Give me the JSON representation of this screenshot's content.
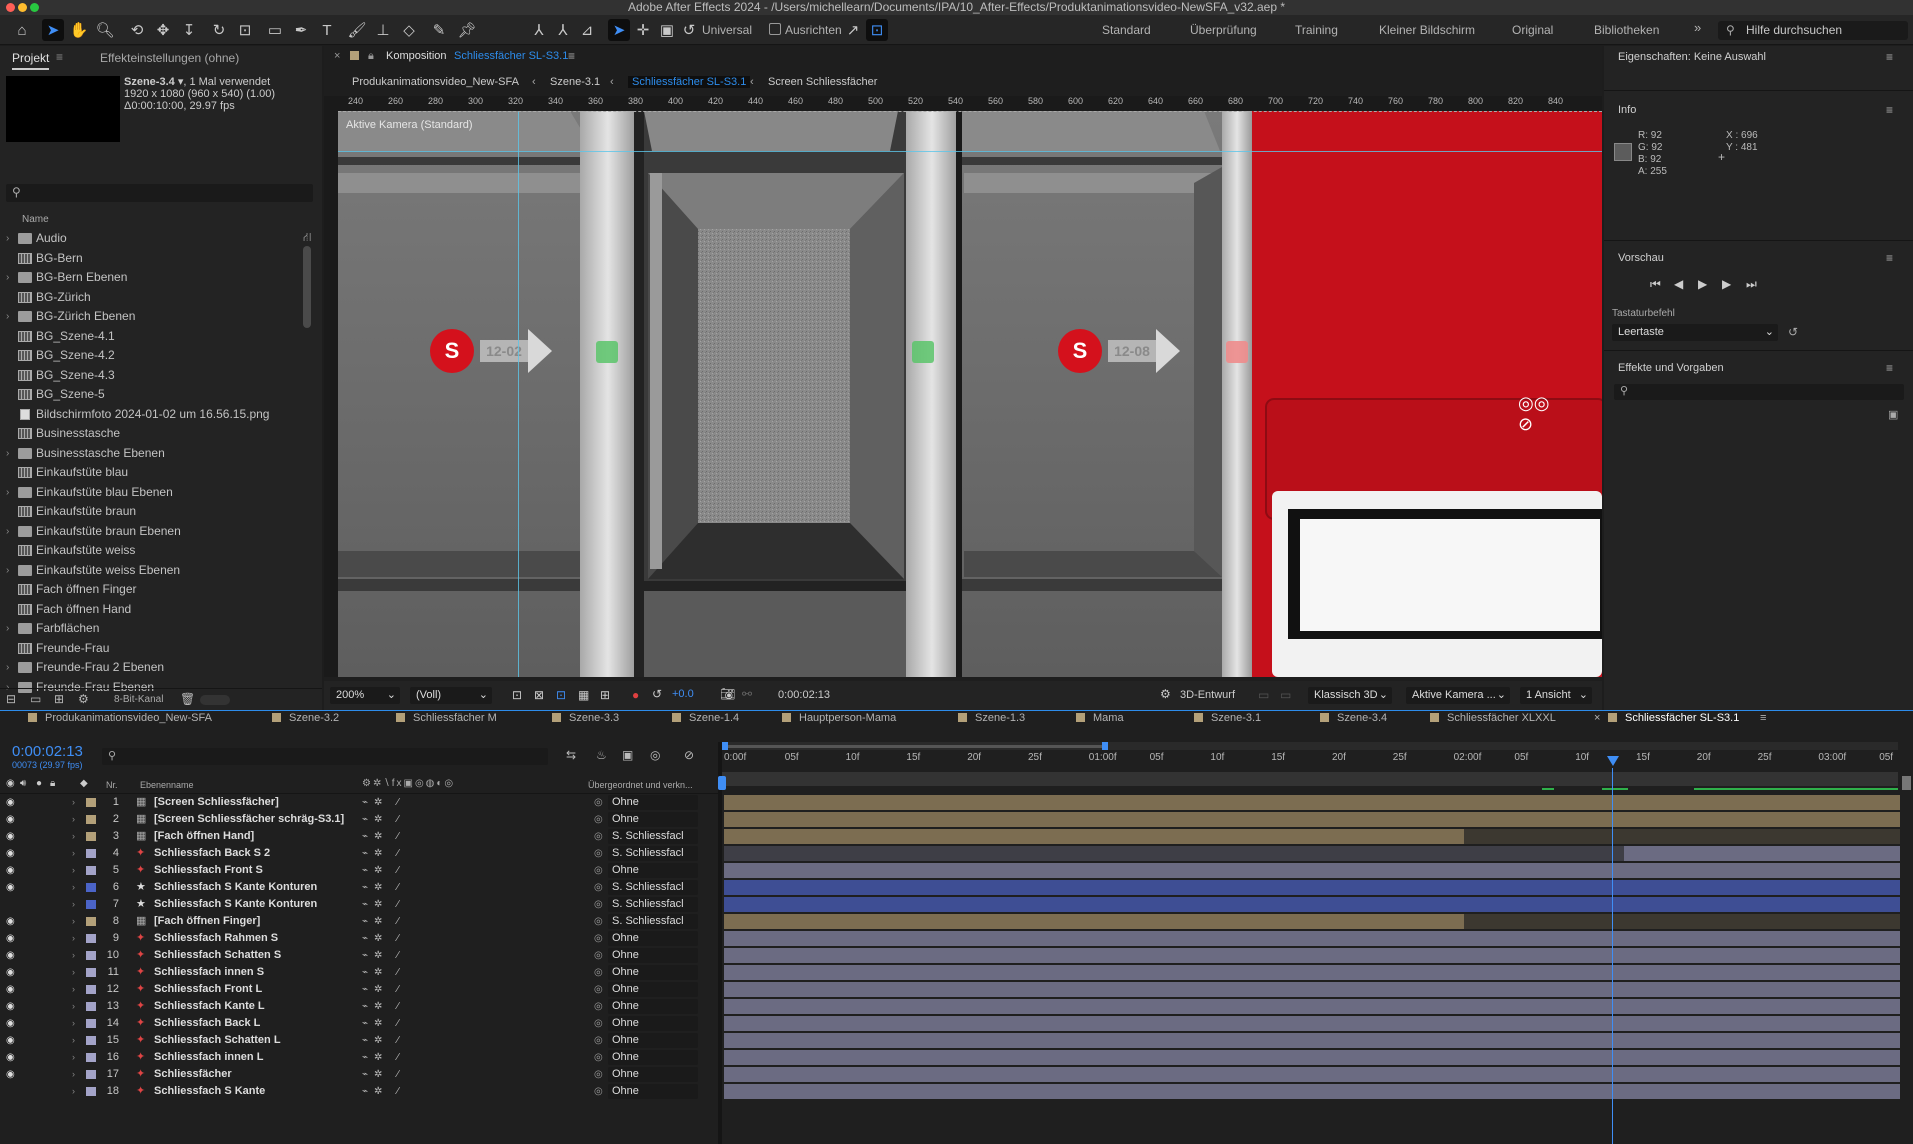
{
  "app_title": "Adobe After Effects 2024 - /Users/michellearn/Documents/IPA/10_After-Effects/Produktanimationsvideo-NewSFA_v32.aep *",
  "toolbar": {
    "universal_label": "Universal",
    "align_label": "Ausrichten",
    "workspaces": [
      "Standard",
      "Überprüfung",
      "Training",
      "Kleiner Bildschirm",
      "Original",
      "Bibliotheken"
    ],
    "search_placeholder": "Hilfe durchsuchen"
  },
  "project_panel": {
    "tab_project": "Projekt",
    "tab_effects": "Effekteinstellungen (ohne)",
    "selected_name": "Szene-3.4",
    "selected_usage": ", 1 Mal verwendet",
    "selected_size": "1920 x 1080 (960 x 540) (1.00)",
    "selected_duration": "Δ0:00:10:00, 29.97 fps",
    "column_name": "Name",
    "bit_depth": "8-Bit-Kanal",
    "items": [
      {
        "label": "Audio",
        "type": "folder",
        "twirl": true
      },
      {
        "label": "BG-Bern",
        "type": "comp",
        "twirl": false
      },
      {
        "label": "BG-Bern Ebenen",
        "type": "folder",
        "twirl": true
      },
      {
        "label": "BG-Zürich",
        "type": "comp",
        "twirl": false
      },
      {
        "label": "BG-Zürich Ebenen",
        "type": "folder",
        "twirl": true
      },
      {
        "label": "BG_Szene-4.1",
        "type": "comp",
        "twirl": false
      },
      {
        "label": "BG_Szene-4.2",
        "type": "comp",
        "twirl": false
      },
      {
        "label": "BG_Szene-4.3",
        "type": "comp",
        "twirl": false
      },
      {
        "label": "BG_Szene-5",
        "type": "comp",
        "twirl": false
      },
      {
        "label": "Bildschirmfoto 2024-01-02 um 16.56.15.png",
        "type": "file",
        "twirl": false
      },
      {
        "label": "Businesstasche",
        "type": "comp",
        "twirl": false
      },
      {
        "label": "Businesstasche Ebenen",
        "type": "folder",
        "twirl": true
      },
      {
        "label": "Einkaufstüte blau",
        "type": "comp",
        "twirl": false
      },
      {
        "label": "Einkaufstüte blau Ebenen",
        "type": "folder",
        "twirl": true
      },
      {
        "label": "Einkaufstüte braun",
        "type": "comp",
        "twirl": false
      },
      {
        "label": "Einkaufstüte braun Ebenen",
        "type": "folder",
        "twirl": true
      },
      {
        "label": "Einkaufstüte weiss",
        "type": "comp",
        "twirl": false
      },
      {
        "label": "Einkaufstüte weiss Ebenen",
        "type": "folder",
        "twirl": true
      },
      {
        "label": "Fach öffnen Finger",
        "type": "comp",
        "twirl": false
      },
      {
        "label": "Fach öffnen Hand",
        "type": "comp",
        "twirl": false
      },
      {
        "label": "Farbflächen",
        "type": "folder",
        "twirl": true
      },
      {
        "label": "Freunde-Frau",
        "type": "comp",
        "twirl": false
      },
      {
        "label": "Freunde-Frau 2 Ebenen",
        "type": "folder",
        "twirl": true
      },
      {
        "label": "Freunde-Frau Ebenen",
        "type": "folder",
        "twirl": true
      }
    ]
  },
  "composition": {
    "tab_prefix": "Komposition",
    "tab_name": "Schliessfächer SL-S3.1",
    "breadcrumbs": [
      "Produkanimationsvideo_New-SFA",
      "Szene-3.1",
      "Schliessfächer SL-S3.1",
      "Screen Schliessfächer"
    ],
    "camera_label": "Aktive Kamera (Standard)",
    "ruler_marks": [
      "240",
      "260",
      "280",
      "300",
      "320",
      "340",
      "360",
      "380",
      "400",
      "420",
      "440",
      "460",
      "480",
      "500",
      "520",
      "540",
      "560",
      "580",
      "600",
      "620",
      "640",
      "660",
      "680",
      "700",
      "720",
      "740",
      "760",
      "780",
      "800",
      "820",
      "840"
    ],
    "locker_badge_1": "S",
    "locker_number_1": "12-02",
    "locker_badge_2": "S",
    "locker_number_2": "12-08",
    "zoom": "200%",
    "resolution": "(Voll)",
    "exposure": "+0.0",
    "timecode": "0:00:02:13",
    "renderer_label": "3D-Entwurf",
    "renderer": "Klassisch 3D",
    "camera": "Aktive Kamera ...",
    "views": "1 Ansicht"
  },
  "right_panel": {
    "properties_title": "Eigenschaften: Keine Auswahl",
    "info_title": "Info",
    "r": "R:  92",
    "g": "G:  92",
    "b": "B:  92",
    "a": "A:  255",
    "x": "X : 696",
    "y": "Y : 481",
    "preview_title": "Vorschau",
    "shortcut_label": "Tastaturbefehl",
    "shortcut_value": "Leertaste",
    "effects_title": "Effekte und Vorgaben"
  },
  "timeline": {
    "tabs": [
      "Produkanimationsvideo_New-SFA",
      "Szene-3.2",
      "Schliessfächer M",
      "Szene-3.3",
      "Szene-1.4",
      "Hauptperson-Mama",
      "Szene-1.3",
      "Mama",
      "Szene-3.1",
      "Szene-3.4",
      "Schliessfächer XLXXL",
      "Schliessfächer SL-S3.1"
    ],
    "current_time": "0:00:02:13",
    "frame_info": "00073 (29.97 fps)",
    "col_nr": "Nr.",
    "col_name": "Ebenenname",
    "col_parent": "Übergeordnet und verkn...",
    "ruler": [
      "0:00f",
      "05f",
      "10f",
      "15f",
      "20f",
      "25f",
      "01:00f",
      "05f",
      "10f",
      "15f",
      "20f",
      "25f",
      "02:00f",
      "05f",
      "10f",
      "15f",
      "20f",
      "25f",
      "03:00f",
      "05f"
    ],
    "layers": [
      {
        "nr": "1",
        "name": "[Screen Schliessfächer]",
        "parent": "Ohne",
        "label": "#b3a079",
        "type": "comp",
        "bar": "#7c6d51",
        "eye": true
      },
      {
        "nr": "2",
        "name": "[Screen Schliessfächer schräg-S3.1]",
        "parent": "Ohne",
        "label": "#b3a079",
        "type": "comp",
        "bar": "#7c6d51",
        "eye": true
      },
      {
        "nr": "3",
        "name": "[Fach öffnen Hand]",
        "parent": "S. Schliessfacl",
        "label": "#b3a079",
        "type": "comp",
        "bar": "#7c6d51",
        "eye": true
      },
      {
        "nr": "4",
        "name": "Schliessfach Back S 2",
        "parent": "S. Schliessfacl",
        "label": "#a3a3c8",
        "type": "shape",
        "bar": "#6b6b82",
        "eye": true
      },
      {
        "nr": "5",
        "name": "Schliessfach Front S",
        "parent": "Ohne",
        "label": "#a3a3c8",
        "type": "shape",
        "bar": "#6b6b82",
        "eye": true
      },
      {
        "nr": "6",
        "name": "Schliessfach S Kante Konturen",
        "parent": "S. Schliessfacl",
        "label": "#4b64c8",
        "type": "star",
        "bar": "#3e4e94",
        "eye": true
      },
      {
        "nr": "7",
        "name": "Schliessfach S Kante Konturen",
        "parent": "S. Schliessfacl",
        "label": "#4b64c8",
        "type": "star",
        "bar": "#3e4e94",
        "eye": false
      },
      {
        "nr": "8",
        "name": "[Fach öffnen Finger]",
        "parent": "S. Schliessfacl",
        "label": "#b3a079",
        "type": "comp",
        "bar": "#7c6d51",
        "eye": true
      },
      {
        "nr": "9",
        "name": "Schliessfach Rahmen S",
        "parent": "Ohne",
        "label": "#a3a3c8",
        "type": "shape",
        "bar": "#6b6b82",
        "eye": true
      },
      {
        "nr": "10",
        "name": "Schliessfach Schatten S",
        "parent": "Ohne",
        "label": "#a3a3c8",
        "type": "shape",
        "bar": "#6b6b82",
        "eye": true
      },
      {
        "nr": "11",
        "name": "Schliessfach innen S",
        "parent": "Ohne",
        "label": "#a3a3c8",
        "type": "shape",
        "bar": "#6b6b82",
        "eye": true
      },
      {
        "nr": "12",
        "name": "Schliessfach Front L",
        "parent": "Ohne",
        "label": "#a3a3c8",
        "type": "shape",
        "bar": "#6b6b82",
        "eye": true
      },
      {
        "nr": "13",
        "name": "Schliessfach Kante L",
        "parent": "Ohne",
        "label": "#a3a3c8",
        "type": "shape",
        "bar": "#6b6b82",
        "eye": true
      },
      {
        "nr": "14",
        "name": "Schliessfach Back L",
        "parent": "Ohne",
        "label": "#a3a3c8",
        "type": "shape",
        "bar": "#6b6b82",
        "eye": true
      },
      {
        "nr": "15",
        "name": "Schliessfach Schatten L",
        "parent": "Ohne",
        "label": "#a3a3c8",
        "type": "shape",
        "bar": "#6b6b82",
        "eye": true
      },
      {
        "nr": "16",
        "name": "Schliessfach innen L",
        "parent": "Ohne",
        "label": "#a3a3c8",
        "type": "shape",
        "bar": "#6b6b82",
        "eye": true
      },
      {
        "nr": "17",
        "name": "Schliessfächer",
        "parent": "Ohne",
        "label": "#a3a3c8",
        "type": "shape",
        "bar": "#6b6b82",
        "eye": true
      },
      {
        "nr": "18",
        "name": "Schliessfach S Kante",
        "parent": "Ohne",
        "label": "#a3a3c8",
        "type": "shape",
        "bar": "#6b6b82",
        "eye": false
      }
    ]
  },
  "colors": {
    "accent": "#2d8ceb",
    "brand_red": "#d2111d",
    "playhead": "#3f8ef5"
  }
}
